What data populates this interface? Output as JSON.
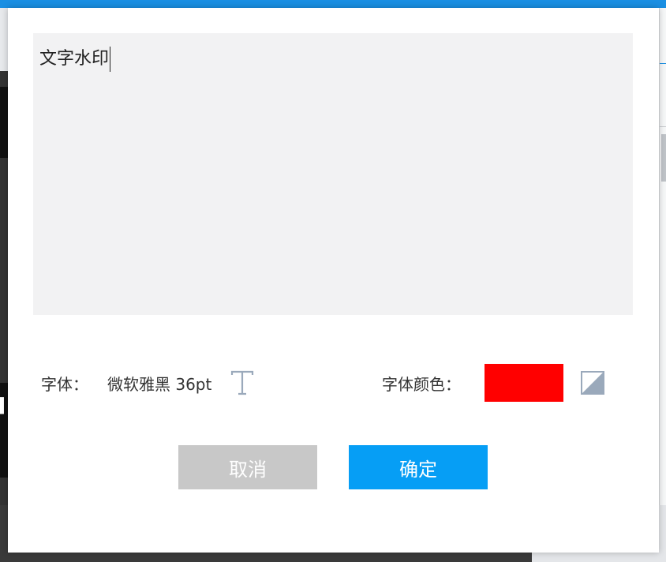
{
  "editor": {
    "text": "文字水印"
  },
  "font": {
    "label": "字体：",
    "value": "微软雅黑 36pt",
    "icon": "text-format-icon"
  },
  "font_color": {
    "label": "字体颜色：",
    "color": "#ff0000",
    "toggle_icon": "background-toggle-icon"
  },
  "buttons": {
    "cancel": "取消",
    "ok": "确定"
  },
  "colors": {
    "primary": "#069ef5",
    "cancel": "#c8c8c8",
    "editor_bg": "#f2f2f3"
  }
}
